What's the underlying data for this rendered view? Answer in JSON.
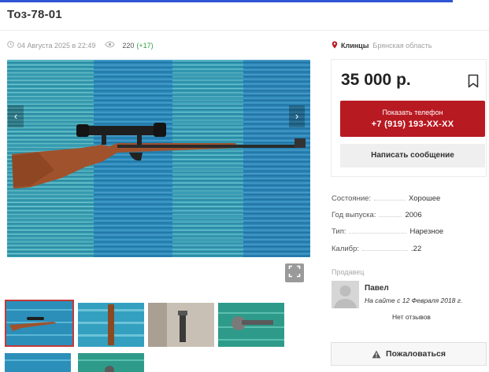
{
  "listing": {
    "title": "Тоз-78-01",
    "date": "04 Августа 2025 в 22:49",
    "views": "220",
    "views_new": "(+17)"
  },
  "location": {
    "city": "Клинцы",
    "region": "Брянская область"
  },
  "offer": {
    "price": "35 000 р.",
    "phone_label": "Показать телефон",
    "phone_number": "+7 (919) 193-XX-XX",
    "message_label": "Написать сообщение"
  },
  "specs": [
    {
      "key": "Состояние:",
      "value": "Хорошее"
    },
    {
      "key": "Год выпуска:",
      "value": "2006"
    },
    {
      "key": "Тип:",
      "value": "Нарезное"
    },
    {
      "key": "Калибр:",
      "value": ".22"
    }
  ],
  "seller": {
    "label": "Продавец",
    "name": "Павел",
    "since": "На сайте с 12 Февраля 2018 г.",
    "reviews": "Нет отзывов"
  },
  "complain_label": "Пожаловаться",
  "icons": {
    "clock": "clock-icon",
    "eye": "eye-icon",
    "pin": "location-pin-icon",
    "bookmark": "bookmark-icon",
    "fullscreen": "fullscreen-icon",
    "warning": "warning-icon",
    "prev": "chevron-left-icon",
    "next": "chevron-right-icon"
  },
  "colors": {
    "accent": "#b81a22",
    "views_new": "#2e9e3e",
    "thumb_active_border": "#c23a3a"
  }
}
